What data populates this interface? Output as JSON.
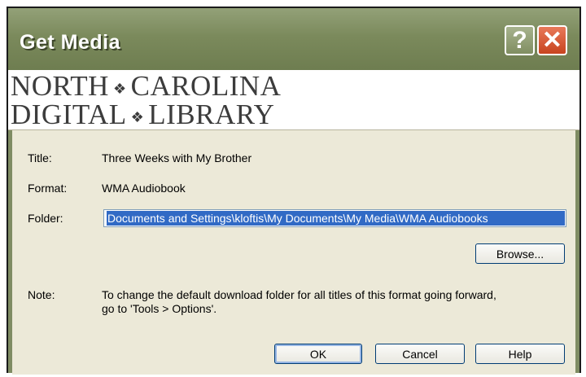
{
  "window": {
    "title": "Get Media",
    "help_glyph": "?",
    "close_glyph": "✕",
    "accent_color": "#7f8c63"
  },
  "banner": {
    "line1_a": "NORTH",
    "line1_b": "CAROLINA",
    "line2_a": "DIGITAL",
    "line2_b": "LIBRARY",
    "diamond": "❖"
  },
  "fields": {
    "title_label": "Title:",
    "title_value": "Three Weeks with My Brother",
    "format_label": "Format:",
    "format_value": "WMA Audiobook",
    "folder_label": "Folder:",
    "folder_value": "Documents and Settings\\kloftis\\My Documents\\My Media\\WMA Audiobooks",
    "note_label": "Note:",
    "note_line1": "To change the default download folder for all titles of this format going forward,",
    "note_line2": "go to 'Tools > Options'."
  },
  "buttons": {
    "browse": "Browse...",
    "ok": "OK",
    "cancel": "Cancel",
    "help": "Help"
  }
}
